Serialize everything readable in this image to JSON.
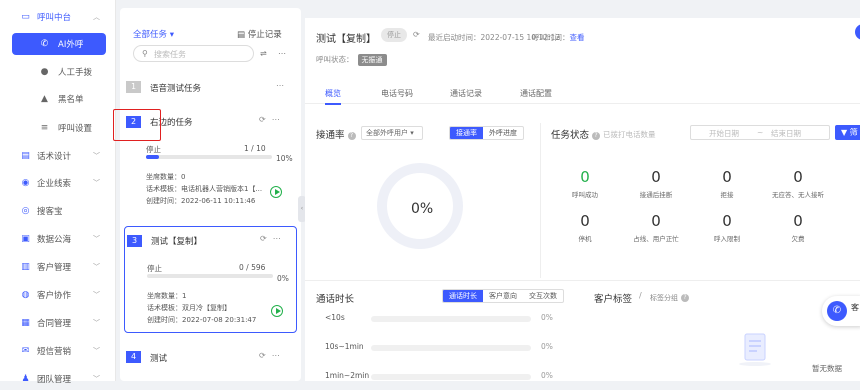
{
  "sidebar": {
    "items": [
      {
        "label": "呼叫中台",
        "icon": "monitor-icon"
      },
      {
        "label": "AI外呼",
        "icon": "phone-icon"
      },
      {
        "label": "人工手拨",
        "icon": "person-icon"
      },
      {
        "label": "黑名单",
        "icon": "warning-icon"
      },
      {
        "label": "呼叫设置",
        "icon": "sliders-icon"
      },
      {
        "label": "话术设计",
        "icon": "book-icon"
      },
      {
        "label": "企业线索",
        "icon": "bulb-icon"
      },
      {
        "label": "搜客宝",
        "icon": "search-circle-icon"
      },
      {
        "label": "数据公海",
        "icon": "database-icon"
      },
      {
        "label": "客户管理",
        "icon": "contact-icon"
      },
      {
        "label": "客户协作",
        "icon": "user-circle-icon"
      },
      {
        "label": "合同管理",
        "icon": "contract-icon"
      },
      {
        "label": "短信营销",
        "icon": "sms-icon"
      },
      {
        "label": "团队管理",
        "icon": "team-icon"
      }
    ]
  },
  "tasks": {
    "filter_label": "全部任务 ▾",
    "stop_record": "停止记录",
    "search_placeholder": "搜索任务",
    "list": [
      {
        "num": "1",
        "name": "语音测试任务"
      },
      {
        "num": "2",
        "name": "右边的任务",
        "status": "停止",
        "count": "1 / 10",
        "pct": "10%",
        "progress": 0.1,
        "seats": "坐席数量：0",
        "script": "话术模板：电话机器人营销版本1【...",
        "created": "创建时间：2022-06-11 10:11:46"
      },
      {
        "num": "3",
        "name": "测试【复制】",
        "status": "停止",
        "count": "0 / 596",
        "pct": "0%",
        "progress": 0,
        "seats": "坐席数量：1",
        "script": "话术模板：双月冷【复制】",
        "created": "创建时间：2022-07-08 20:31:47"
      },
      {
        "num": "4",
        "name": "测试"
      }
    ]
  },
  "main": {
    "title": "测试【复制】",
    "stop_badge": "停止",
    "last_run": "最近启动时间：2022-07-15 10:12:12",
    "period_label": "呼叫时间：",
    "period_value": "查看",
    "call_state_label": "呼叫状态：",
    "call_state_value": "无振通",
    "tabs": [
      "概览",
      "电话号码",
      "通话记录",
      "通话配置"
    ],
    "connect_rate": {
      "title": "接通率",
      "select": "全部外呼用户",
      "seg": [
        "接通率",
        "外呼进度"
      ],
      "value": "0%"
    },
    "task_status": {
      "title": "任务状态",
      "hint": "已拨打电话数量",
      "start_date": "开始日期",
      "tilde": "~",
      "end_date": "结束日期",
      "filter": "筛",
      "stats_row1": [
        {
          "value": "0",
          "label": "呼叫成功",
          "highlight": true
        },
        {
          "value": "0",
          "label": "接通后挂断"
        },
        {
          "value": "0",
          "label": "拒接"
        },
        {
          "value": "0",
          "label": "无应答、无人接听"
        }
      ],
      "stats_row2": [
        {
          "value": "0",
          "label": "停机"
        },
        {
          "value": "0",
          "label": "占线、用户正忙"
        },
        {
          "value": "0",
          "label": "呼入限制"
        },
        {
          "value": "0",
          "label": "欠费"
        }
      ]
    },
    "duration": {
      "title": "通话时长",
      "seg": [
        "通话时长",
        "客户意向",
        "交互次数"
      ],
      "rows": [
        {
          "label": "<10s",
          "pct": "0%"
        },
        {
          "label": "10s~1min",
          "pct": "0%"
        },
        {
          "label": "1min~2min",
          "pct": "0%"
        }
      ]
    },
    "customer_tags": {
      "title": "客户标签",
      "slash": "/",
      "sub": "标签分组",
      "empty": "暂无数据"
    },
    "float_label": "客"
  },
  "colors": {
    "accent": "#3d5afe",
    "success": "#22b04b",
    "highlight_box": "#e02020"
  }
}
